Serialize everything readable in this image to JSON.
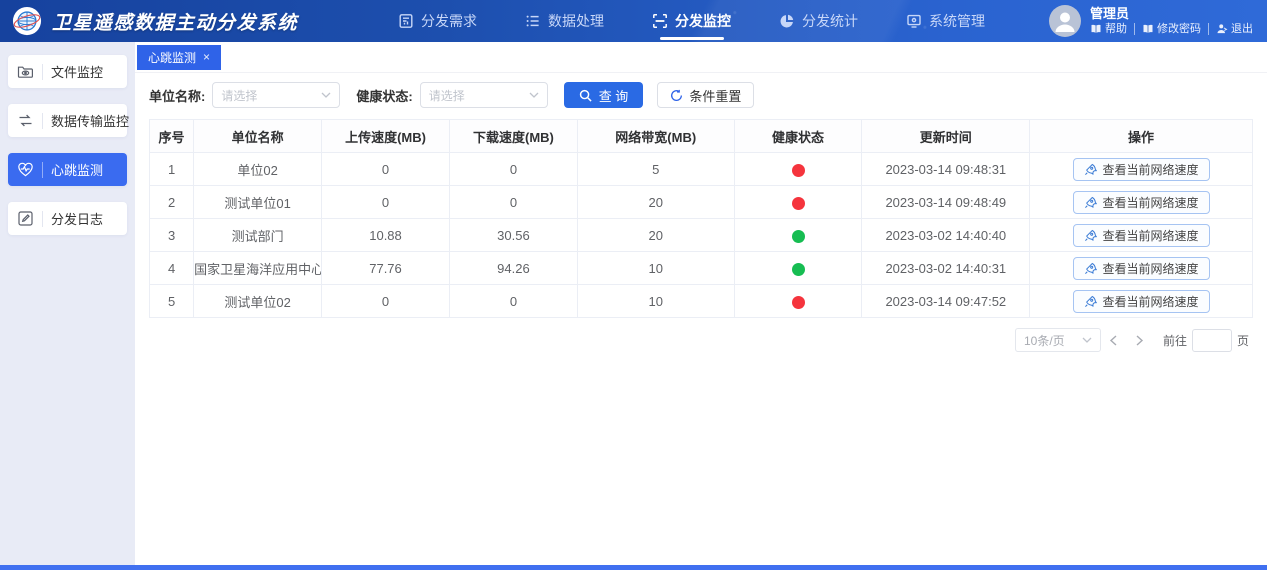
{
  "app": {
    "title": "卫星遥感数据主动分发系统"
  },
  "nav": {
    "items": [
      {
        "label": "分发需求",
        "icon": "document-icon",
        "active": false
      },
      {
        "label": "数据处理",
        "icon": "list-icon",
        "active": false
      },
      {
        "label": "分发监控",
        "icon": "scan-monitor-icon",
        "active": true
      },
      {
        "label": "分发统计",
        "icon": "pie-chart-icon",
        "active": false
      },
      {
        "label": "系统管理",
        "icon": "system-icon",
        "active": false
      }
    ]
  },
  "user": {
    "name": "管理员",
    "links": [
      {
        "label": "帮助",
        "icon": "book-icon"
      },
      {
        "label": "修改密码",
        "icon": "book-icon"
      },
      {
        "label": "退出",
        "icon": "logout-person-icon"
      }
    ]
  },
  "sidebar": {
    "items": [
      {
        "label": "文件监控",
        "icon": "folder-eye-icon",
        "active": false
      },
      {
        "label": "数据传输监控",
        "icon": "transfer-icon",
        "active": false
      },
      {
        "label": "心跳监测",
        "icon": "heartbeat-icon",
        "active": true
      },
      {
        "label": "分发日志",
        "icon": "log-edit-icon",
        "active": false
      }
    ]
  },
  "tabs": [
    {
      "label": "心跳监测",
      "active": true,
      "closable": true
    }
  ],
  "filters": {
    "unit_label": "单位名称:",
    "unit_placeholder": "请选择",
    "health_label": "健康状态:",
    "health_placeholder": "请选择",
    "search_label": "查 询",
    "reset_label": "条件重置"
  },
  "table": {
    "columns": [
      "序号",
      "单位名称",
      "上传速度(MB)",
      "下载速度(MB)",
      "网络带宽(MB)",
      "健康状态",
      "更新时间",
      "操作"
    ],
    "action_label": "查看当前网络速度",
    "rows": [
      {
        "index": "1",
        "unit": "单位02",
        "upload": "0",
        "download": "0",
        "bandwidth": "5",
        "health": "red",
        "updated": "2023-03-14 09:48:31"
      },
      {
        "index": "2",
        "unit": "测试单位01",
        "upload": "0",
        "download": "0",
        "bandwidth": "20",
        "health": "red",
        "updated": "2023-03-14 09:48:49"
      },
      {
        "index": "3",
        "unit": "测试部门",
        "upload": "10.88",
        "download": "30.56",
        "bandwidth": "20",
        "health": "green",
        "updated": "2023-03-02 14:40:40"
      },
      {
        "index": "4",
        "unit": "国家卫星海洋应用中心",
        "upload": "77.76",
        "download": "94.26",
        "bandwidth": "10",
        "health": "green",
        "updated": "2023-03-02 14:40:31"
      },
      {
        "index": "5",
        "unit": "测试单位02",
        "upload": "0",
        "download": "0",
        "bandwidth": "10",
        "health": "red",
        "updated": "2023-03-14 09:47:52"
      }
    ]
  },
  "pagination": {
    "page_size": "10条/页",
    "goto_label": "前往",
    "page_unit": "页"
  },
  "colors": {
    "accent": "#2f63e8",
    "header_gradient_start": "#16429e",
    "header_gradient_end": "#2f6ad8",
    "status_red": "#f5343d",
    "status_green": "#16bd52",
    "sidebar_bg": "#e8ebf6",
    "bottom_bar": "#4070f0"
  }
}
